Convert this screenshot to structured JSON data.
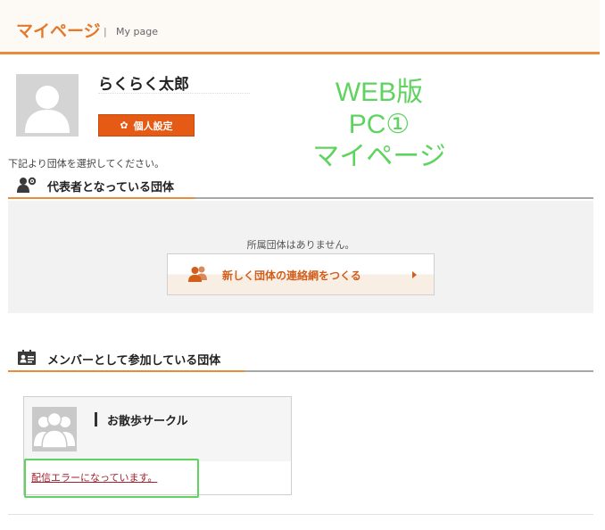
{
  "header": {
    "title": "マイページ",
    "separator": "|",
    "subtitle": "My page"
  },
  "profile": {
    "avatar_icon": "user-silhouette-icon",
    "name": "らくらく太郎",
    "settings_button": {
      "icon": "gear-icon",
      "label": "個人設定"
    }
  },
  "annotation": {
    "lines": [
      "WEB版",
      "PC①",
      "マイページ"
    ],
    "color": "#5fd35f"
  },
  "instruction": "下記より団体を選択してください。",
  "representative_section": {
    "icon": "user-gear-icon",
    "label": "代表者となっている団体",
    "empty_message": "所属団体はありません。",
    "create_button": {
      "icon": "users-icon",
      "label": "新しく団体の連絡網をつくる",
      "arrow_icon": "triangle-right-icon"
    }
  },
  "member_section": {
    "icon": "member-card-icon",
    "label": "メンバーとして参加している団体",
    "groups": [
      {
        "thumb_icon": "group-silhouette-icon",
        "name": "お散歩サークル",
        "status_link": "配信エラーになっています。"
      }
    ]
  },
  "colors": {
    "accent_orange": "#e88b3a",
    "button_orange": "#e55a14",
    "link_red": "#a4202c",
    "highlight_green": "#5fd35f"
  }
}
